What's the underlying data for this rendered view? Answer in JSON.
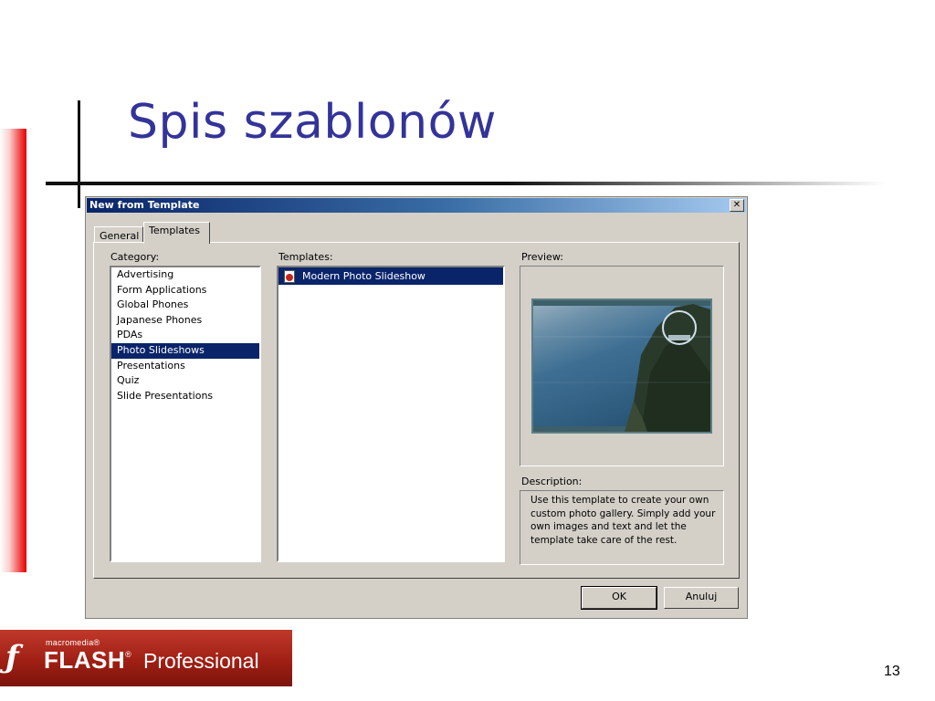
{
  "slide": {
    "title": "Spis szablonów",
    "page_number": "13"
  },
  "logo": {
    "macromedia": "macromedia®",
    "flash": "FLASH",
    "registered": "®",
    "professional": "Professional"
  },
  "dialog": {
    "title": "New from Template",
    "close_glyph": "✕",
    "tabs": [
      {
        "label": "General",
        "active": false
      },
      {
        "label": "Templates",
        "active": true
      }
    ],
    "category_label": "Category:",
    "categories": [
      "Advertising",
      "Form Applications",
      "Global Phones",
      "Japanese Phones",
      "PDAs",
      "Photo Slideshows",
      "Presentations",
      "Quiz",
      "Slide Presentations"
    ],
    "selected_category": "Photo Slideshows",
    "templates_label": "Templates:",
    "templates": [
      "Modern Photo Slideshow"
    ],
    "preview_label": "Preview:",
    "description_label": "Description:",
    "description": "Use this template to create your own custom photo gallery. Simply add your own images and text and let the template take care of the rest.",
    "ok_label": "OK",
    "cancel_label": "Anuluj"
  },
  "colors": {
    "title_blue": "#33339a",
    "titlebar_start": "#0a246a",
    "selection": "#0a246a",
    "dialog_face": "#d4d0c8",
    "logo_red": "#a01f14"
  }
}
